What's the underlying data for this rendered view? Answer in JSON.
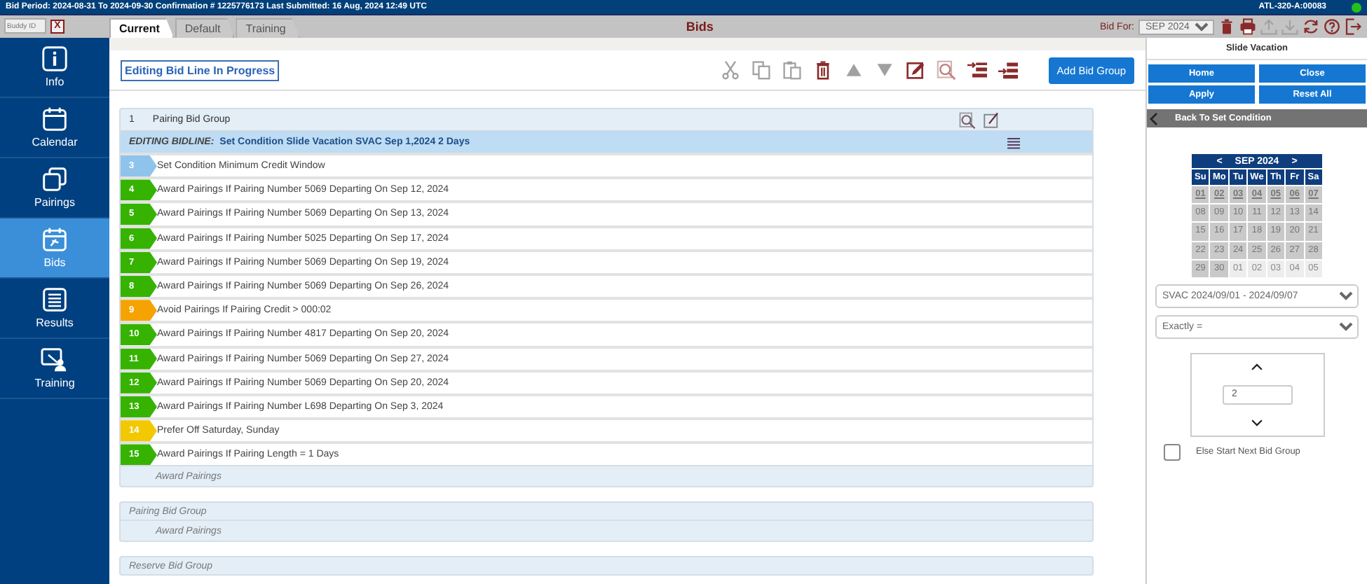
{
  "top_bar": {
    "period": "Bid Period: 2024-08-31 To 2024-09-30 Confirmation # 1225776173 Last Submitted: 16 Aug, 2024 12:49 UTC",
    "user": "ATL-320-A:00083",
    "online": true
  },
  "header": {
    "buddy_placeholder": "Buddy ID",
    "close": "X",
    "title": "Bids",
    "bid_for_label": "Bid For:",
    "bid_for_value": "SEP 2024",
    "tabs": [
      {
        "label": "Current",
        "selected": true
      },
      {
        "label": "Default",
        "selected": false
      },
      {
        "label": "Training",
        "selected": false
      }
    ]
  },
  "sidebar": {
    "items": [
      {
        "label": "Info",
        "selected": false
      },
      {
        "label": "Calendar",
        "selected": false
      },
      {
        "label": "Pairings",
        "selected": false
      },
      {
        "label": "Bids",
        "selected": true
      },
      {
        "label": "Results",
        "selected": false
      },
      {
        "label": "Training",
        "selected": false
      }
    ]
  },
  "toolbar": {
    "status": "Editing Bid Line In Progress",
    "add_button": "Add Bid Group"
  },
  "groups": [
    {
      "number": "1",
      "title": "Pairing Bid Group",
      "expanded": true,
      "editing": "EDITING BIDLINE:",
      "editing_text": "Set Condition Slide Vacation SVAC Sep 1,2024 2 Days",
      "lines": [
        {
          "number": "3",
          "text": "Set Condition Minimum Credit Window",
          "color": "#8ec4ec"
        },
        {
          "number": "4",
          "text": "Award Pairings If Pairing Number 5069 Departing On Sep 12, 2024",
          "color": "#36b300"
        },
        {
          "number": "5",
          "text": "Award Pairings If Pairing Number 5069 Departing On Sep 13, 2024",
          "color": "#36b300"
        },
        {
          "number": "6",
          "text": "Award Pairings If Pairing Number 5025 Departing On Sep 17, 2024",
          "color": "#36b300"
        },
        {
          "number": "7",
          "text": "Award Pairings If Pairing Number 5069 Departing On Sep 19, 2024",
          "color": "#36b300"
        },
        {
          "number": "8",
          "text": "Award Pairings If Pairing Number 5069 Departing On Sep 26, 2024",
          "color": "#36b300"
        },
        {
          "number": "9",
          "text": "Avoid Pairings If Pairing Credit > 000:02",
          "color": "#f5a300"
        },
        {
          "number": "10",
          "text": "Award Pairings If Pairing Number 4817 Departing On Sep 20, 2024",
          "color": "#36b300"
        },
        {
          "number": "11",
          "text": "Award Pairings If Pairing Number 5069 Departing On Sep 27, 2024",
          "color": "#36b300"
        },
        {
          "number": "12",
          "text": "Award Pairings If Pairing Number 5069 Departing On Sep 20, 2024",
          "color": "#36b300"
        },
        {
          "number": "13",
          "text": "Award Pairings If Pairing Number L698 Departing On Sep 3, 2024",
          "color": "#36b300"
        },
        {
          "number": "14",
          "text": "Prefer Off Saturday, Sunday",
          "color": "#f2c900"
        },
        {
          "number": "15",
          "text": "Award Pairings If Pairing Length = 1 Days",
          "color": "#36b300"
        }
      ],
      "footer": "Award Pairings"
    },
    {
      "title": "Pairing Bid Group",
      "expanded": false,
      "footer": "Award Pairings"
    },
    {
      "title": "Reserve Bid Group",
      "expanded": false
    }
  ],
  "panel": {
    "title": "Slide Vacation",
    "buttons": [
      "Home",
      "Close",
      "Apply",
      "Reset All"
    ],
    "back": "Back To Set Condition",
    "calendar": {
      "prev": "<",
      "month": "SEP 2024",
      "next": ">",
      "weekdays": [
        "Su",
        "Mo",
        "Tu",
        "We",
        "Th",
        "Fr",
        "Sa"
      ],
      "days": [
        {
          "label": "01",
          "selected": true,
          "outside": false
        },
        {
          "label": "02",
          "selected": true,
          "outside": false
        },
        {
          "label": "03",
          "selected": true,
          "outside": false
        },
        {
          "label": "04",
          "selected": true,
          "outside": false
        },
        {
          "label": "05",
          "selected": true,
          "outside": false
        },
        {
          "label": "06",
          "selected": true,
          "outside": false
        },
        {
          "label": "07",
          "selected": true,
          "outside": false
        },
        {
          "label": "08",
          "selected": false,
          "outside": false
        },
        {
          "label": "09",
          "selected": false,
          "outside": false
        },
        {
          "label": "10",
          "selected": false,
          "outside": false
        },
        {
          "label": "11",
          "selected": false,
          "outside": false
        },
        {
          "label": "12",
          "selected": false,
          "outside": false
        },
        {
          "label": "13",
          "selected": false,
          "outside": false
        },
        {
          "label": "14",
          "selected": false,
          "outside": false
        },
        {
          "label": "15",
          "selected": false,
          "outside": false
        },
        {
          "label": "16",
          "selected": false,
          "outside": false
        },
        {
          "label": "17",
          "selected": false,
          "outside": false
        },
        {
          "label": "18",
          "selected": false,
          "outside": false
        },
        {
          "label": "19",
          "selected": false,
          "outside": false
        },
        {
          "label": "20",
          "selected": false,
          "outside": false
        },
        {
          "label": "21",
          "selected": false,
          "outside": false
        },
        {
          "label": "22",
          "selected": false,
          "outside": false
        },
        {
          "label": "23",
          "selected": false,
          "outside": false
        },
        {
          "label": "24",
          "selected": false,
          "outside": false
        },
        {
          "label": "25",
          "selected": false,
          "outside": false
        },
        {
          "label": "26",
          "selected": false,
          "outside": false
        },
        {
          "label": "27",
          "selected": false,
          "outside": false
        },
        {
          "label": "28",
          "selected": false,
          "outside": false
        },
        {
          "label": "29",
          "selected": false,
          "outside": false
        },
        {
          "label": "30",
          "selected": false,
          "outside": false
        },
        {
          "label": "01",
          "selected": false,
          "outside": true
        },
        {
          "label": "02",
          "selected": false,
          "outside": true
        },
        {
          "label": "03",
          "selected": false,
          "outside": true
        },
        {
          "label": "04",
          "selected": false,
          "outside": true
        },
        {
          "label": "05",
          "selected": false,
          "outside": true
        }
      ]
    },
    "range_select": "SVAC 2024/09/01 - 2024/09/07",
    "operator_select": "Exactly =",
    "value": "2",
    "else_label": "Else Start Next Bid Group",
    "else_checked": false
  }
}
